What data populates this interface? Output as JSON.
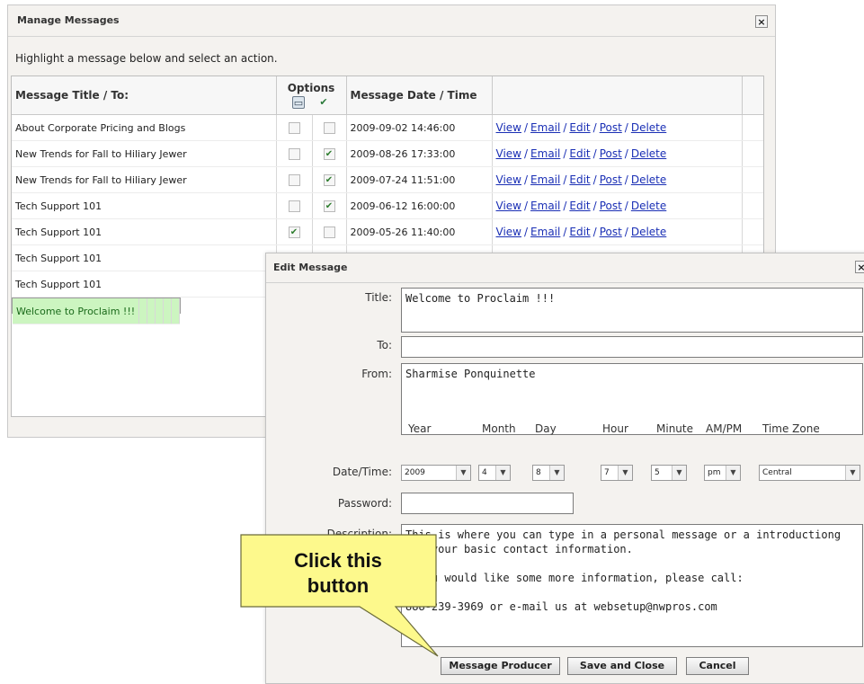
{
  "manage": {
    "title": "Manage Messages",
    "instruction": "Highlight a message below and select an action.",
    "columns": {
      "title": "Message Title / To:",
      "options": "Options",
      "date": "Message Date / Time"
    },
    "rows": [
      {
        "title": "About Corporate Pricing and Blogs",
        "opt1": false,
        "opt2": false,
        "date": "2009-09-02 14:46:00",
        "selected": false
      },
      {
        "title": "New Trends for Fall to Hiliary Jewer",
        "opt1": false,
        "opt2": true,
        "date": "2009-08-26 17:33:00",
        "selected": false
      },
      {
        "title": "New Trends for Fall to Hiliary Jewer",
        "opt1": false,
        "opt2": true,
        "date": "2009-07-24 11:51:00",
        "selected": false
      },
      {
        "title": "Tech Support 101",
        "opt1": false,
        "opt2": true,
        "date": "2009-06-12 16:00:00",
        "selected": false
      },
      {
        "title": "Tech Support 101",
        "opt1": true,
        "opt2": false,
        "date": "2009-05-26 11:40:00",
        "selected": false
      },
      {
        "title": "Tech Support 101",
        "selected": false
      },
      {
        "title": "Tech Support 101",
        "selected": false
      },
      {
        "title": "Welcome to Proclaim !!!",
        "selected": true
      }
    ],
    "actions": [
      "View",
      "Email",
      "Edit",
      "Post",
      "Delete"
    ],
    "action_separator": "/",
    "close_glyph": "×"
  },
  "edit": {
    "title": "Edit Message",
    "close_glyph": "×",
    "labels": {
      "title": "Title:",
      "to": "To:",
      "from": "From:",
      "datetime": "Date/Time:",
      "password": "Password:",
      "description": "Description:"
    },
    "values": {
      "title": "Welcome to Proclaim !!!",
      "to": "",
      "from": "Sharmise Ponquinette",
      "password": "",
      "description": "This is where you can type in a personal message or a introductiong\n    your basic contact information.\n\n    u would like some more information, please call:\n\n888-239-3969 or e-mail us at websetup@nwpros.com"
    },
    "datetime": {
      "headers": [
        "Year",
        "Month",
        "Day",
        "Hour",
        "Minute",
        "AM/PM",
        "Time Zone"
      ],
      "year": "2009",
      "month": "4",
      "day": "8",
      "hour": "7",
      "minute": "5",
      "ampm": "pm",
      "timezone": "Central"
    },
    "buttons": {
      "producer": "Message Producer",
      "save": "Save and Close",
      "cancel": "Cancel"
    }
  },
  "callout": {
    "line1": "Click this",
    "line2": "button",
    "fill": "#fdf98c"
  },
  "colors": {
    "link": "#1a2fb5",
    "selected_row": "#ccf5c0",
    "check": "#2e7d2e"
  }
}
